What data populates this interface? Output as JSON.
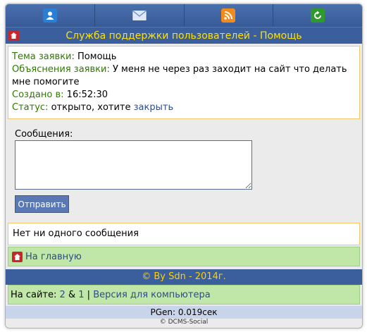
{
  "nav": {
    "icons": [
      "user-icon",
      "mail-icon",
      "rss-icon",
      "refresh-icon"
    ]
  },
  "header": {
    "title": "Служба поддержки пользователей - Помощь"
  },
  "ticket": {
    "subject_label": "Тема заявки:",
    "subject_value": "Помощь",
    "explain_label": "Объяснения заявки:",
    "explain_value": "У меня не через раз заходит на сайт что делать мне помогите",
    "created_label": "Создано в:",
    "created_value": "16:52:30",
    "status_label": "Статус:",
    "status_value": "открыто, хотите",
    "close_link": "закрыть"
  },
  "form": {
    "messages_label": "Сообщения:",
    "message_value": "",
    "send_label": "Отправить"
  },
  "messages": {
    "empty_text": "Нет ни одного сообщения"
  },
  "footer": {
    "home_link": "На главную",
    "copyright": "© By Sdn - 2014г.",
    "online_label": "На сайте:",
    "online_count_1": "2",
    "amp": "&",
    "online_count_2": "1",
    "separator": "|",
    "desktop_link": "Версия для компьютера",
    "pgen": "PGen: 0.019сек",
    "powered": "DCMS-Social"
  },
  "colors": {
    "accent": "#3b5e9c",
    "title_text": "#ffe100",
    "label_green": "#2d7a00",
    "link": "#2b4d8c",
    "green_bar": "#c0e6a8"
  }
}
